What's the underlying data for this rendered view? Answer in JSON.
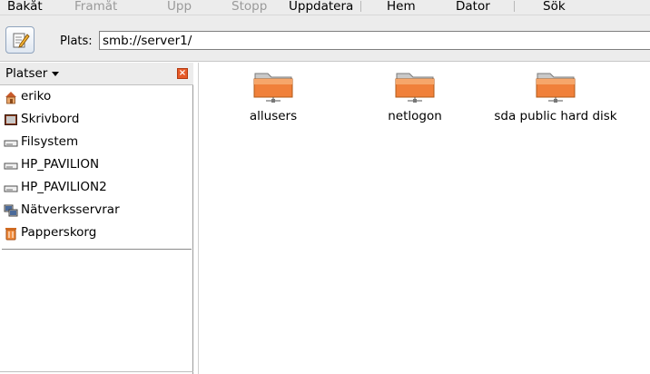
{
  "toolbar": {
    "back": "Bakåt",
    "forward": "Framåt",
    "up": "Upp",
    "stop": "Stopp",
    "reload": "Uppdatera",
    "home": "Hem",
    "computer": "Dator",
    "search": "Sök"
  },
  "location": {
    "label": "Plats:",
    "value": "smb://server1/"
  },
  "sidebar": {
    "title": "Platser",
    "items": [
      {
        "label": "eriko",
        "icon": "home-icon"
      },
      {
        "label": "Skrivbord",
        "icon": "desktop-icon"
      },
      {
        "label": "Filsystem",
        "icon": "drive-icon"
      },
      {
        "label": "HP_PAVILION",
        "icon": "drive-icon"
      },
      {
        "label": "HP_PAVILION2",
        "icon": "drive-icon"
      },
      {
        "label": "Nätverksservrar",
        "icon": "network-icon"
      },
      {
        "label": "Papperskorg",
        "icon": "trash-icon"
      }
    ]
  },
  "main": {
    "shares": [
      {
        "label": "allusers",
        "icon": "network-folder-icon"
      },
      {
        "label": "netlogon",
        "icon": "network-folder-icon"
      },
      {
        "label": "sda public hard disk",
        "icon": "network-folder-icon"
      }
    ]
  },
  "colors": {
    "folder": "#f0803a",
    "toolbar_bg": "#ececec",
    "close_button": "#e65a28"
  }
}
